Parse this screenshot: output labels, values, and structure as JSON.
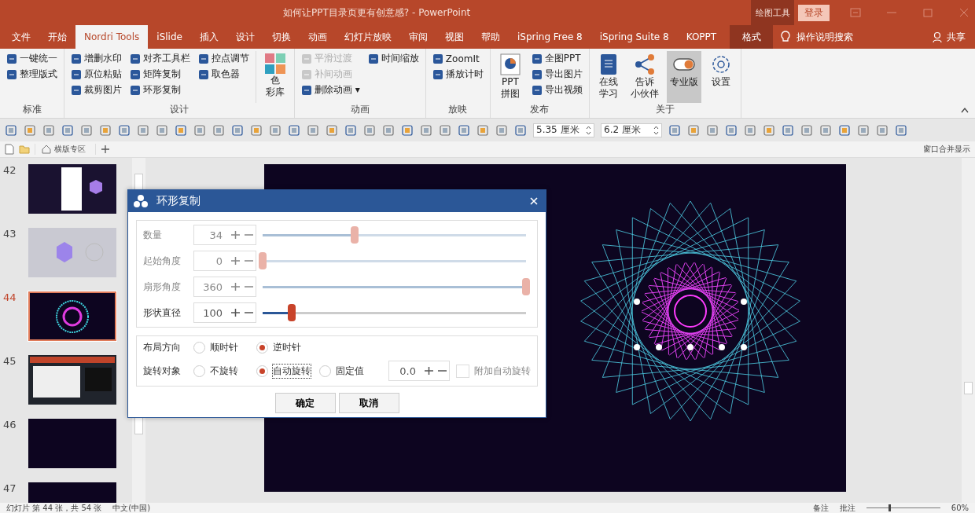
{
  "window": {
    "title": "如何让PPT目录页更有创意感?  -  PowerPoint",
    "context_label": "绘图工具",
    "login": "登录"
  },
  "tabs": [
    {
      "label": "文件",
      "selected": false
    },
    {
      "label": "开始",
      "selected": false
    },
    {
      "label": "Nordri Tools",
      "selected": true
    },
    {
      "label": "iSlide",
      "selected": false
    },
    {
      "label": "插入",
      "selected": false
    },
    {
      "label": "设计",
      "selected": false
    },
    {
      "label": "切换",
      "selected": false
    },
    {
      "label": "动画",
      "selected": false
    },
    {
      "label": "幻灯片放映",
      "selected": false
    },
    {
      "label": "审阅",
      "selected": false
    },
    {
      "label": "视图",
      "selected": false
    },
    {
      "label": "帮助",
      "selected": false
    },
    {
      "label": "iSpring Free 8",
      "selected": false
    },
    {
      "label": "iSpring Suite 8",
      "selected": false
    },
    {
      "label": "KOPPT",
      "selected": false
    },
    {
      "label": "格式",
      "selected": false
    }
  ],
  "tell_me": "操作说明搜索",
  "share": "共享",
  "ribbon": [
    {
      "label": "标准",
      "columns": [
        [
          {
            "label": "一键统一",
            "disabled": false
          },
          {
            "label": "整理版式",
            "disabled": false
          }
        ]
      ]
    },
    {
      "label": "设计",
      "columns": [
        [
          {
            "label": "增删水印",
            "disabled": false
          },
          {
            "label": "原位粘贴",
            "disabled": false
          },
          {
            "label": "裁剪图片",
            "disabled": false
          }
        ],
        [
          {
            "label": "对齐工具栏",
            "disabled": false
          },
          {
            "label": "矩阵复制",
            "disabled": false
          },
          {
            "label": "环形复制",
            "disabled": false
          }
        ],
        [
          {
            "label": "控点调节",
            "disabled": false
          },
          {
            "label": "取色器",
            "disabled": false
          }
        ]
      ],
      "large": [
        {
          "lines": [
            "色",
            "彩库"
          ],
          "selected": false
        }
      ]
    },
    {
      "label": "动画",
      "columns": [
        [
          {
            "label": "平滑过渡",
            "disabled": true
          },
          {
            "label": "补间动画",
            "disabled": true
          },
          {
            "label": "删除动画 ▾",
            "disabled": false
          }
        ],
        [
          {
            "label": "时间缩放",
            "disabled": false
          }
        ]
      ]
    },
    {
      "label": "放映",
      "columns": [
        [
          {
            "label": "ZoomIt",
            "disabled": false
          },
          {
            "label": "播放计时",
            "disabled": false
          }
        ]
      ]
    },
    {
      "label": "发布",
      "large": [
        {
          "lines": [
            "PPT",
            "拼图"
          ],
          "selected": false
        }
      ],
      "columns": [
        [
          {
            "label": "全图PPT",
            "disabled": false
          },
          {
            "label": "导出图片",
            "disabled": false
          },
          {
            "label": "导出视频",
            "disabled": false
          }
        ]
      ]
    },
    {
      "label": "关于",
      "large": [
        {
          "lines": [
            "在线",
            "学习"
          ],
          "selected": false
        },
        {
          "lines": [
            "告诉",
            "小伙伴"
          ],
          "selected": false
        },
        {
          "lines": [
            "专业版"
          ],
          "selected": true
        },
        {
          "lines": [
            "设置"
          ],
          "selected": false
        }
      ]
    }
  ],
  "size_fields": [
    "5.35 厘米",
    "6.2 厘米"
  ],
  "doc_tab": "横版专区",
  "merge_label": "窗口合并显示",
  "slides": [
    {
      "number": "42",
      "kind": "doc",
      "selected": false
    },
    {
      "number": "43",
      "kind": "grey",
      "selected": false
    },
    {
      "number": "44",
      "kind": "ring",
      "selected": true
    },
    {
      "number": "45",
      "kind": "screen",
      "selected": false
    },
    {
      "number": "46",
      "kind": "dark",
      "selected": false
    },
    {
      "number": "47",
      "kind": "dark",
      "selected": false
    }
  ],
  "dialog": {
    "title": "环形复制",
    "sliders": [
      {
        "label": "数量",
        "value": "34",
        "level": 0.35,
        "disabled": true
      },
      {
        "label": "起始角度",
        "value": "0",
        "level": 0,
        "disabled": true
      },
      {
        "label": "扇形角度",
        "value": "360",
        "level": 1,
        "disabled": true
      },
      {
        "label": "形状直径",
        "value": "100",
        "level": 0.11,
        "disabled": false
      }
    ],
    "radio_rows": [
      {
        "label": "布局方向",
        "options": [
          {
            "label": "顺时针",
            "selected": false
          },
          {
            "label": "逆时针",
            "selected": true
          }
        ]
      },
      {
        "label": "旋转对象",
        "options": [
          {
            "label": "不旋转",
            "selected": false
          },
          {
            "label": "自动旋转",
            "selected": true
          },
          {
            "label": "固定值",
            "selected": false
          }
        ],
        "value": "0.0",
        "checkbox": {
          "label": "附加自动旋转",
          "checked": false
        }
      }
    ],
    "buttons": [
      "确定",
      "取消"
    ]
  },
  "status": {
    "slide": "幻灯片 第 44 张，共 54 张",
    "language": "中文(中国)",
    "notes": "备注",
    "comments": "批注",
    "zoom": "60%",
    "zoom_slider": {
      "level": 0.3
    }
  }
}
